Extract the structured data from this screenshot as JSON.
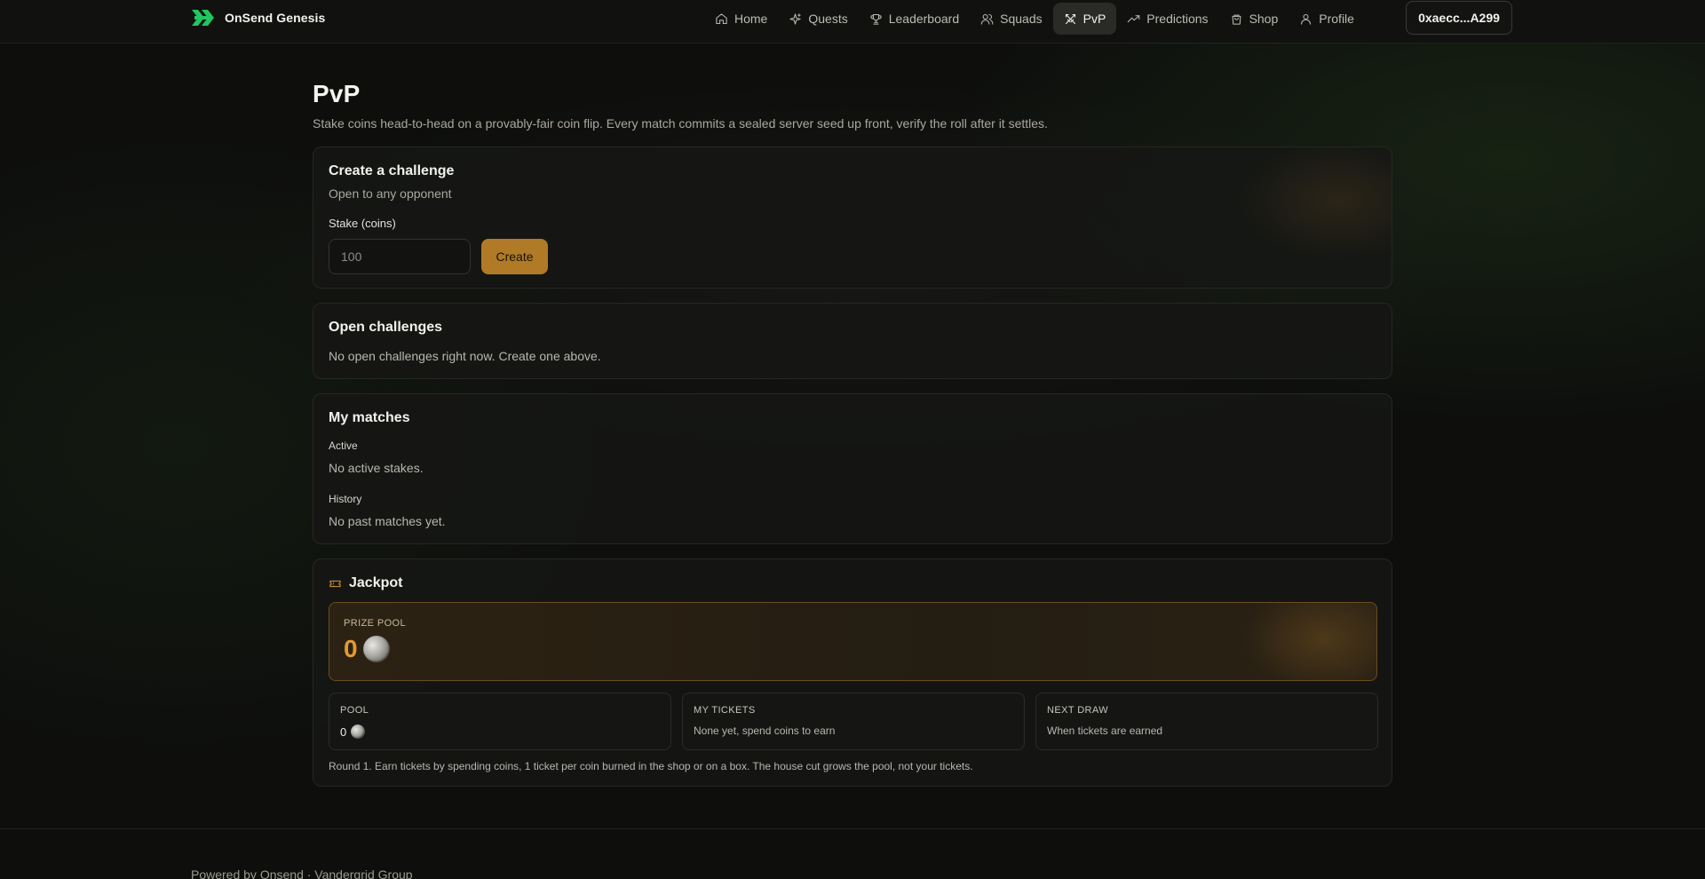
{
  "brand": {
    "name": "OnSend Genesis",
    "accent": "#22c55e"
  },
  "nav": {
    "items": [
      {
        "label": "Home",
        "icon": "home-icon"
      },
      {
        "label": "Quests",
        "icon": "sparkles-icon"
      },
      {
        "label": "Leaderboard",
        "icon": "trophy-icon"
      },
      {
        "label": "Squads",
        "icon": "users-icon"
      },
      {
        "label": "PvP",
        "icon": "swords-icon",
        "active": true
      },
      {
        "label": "Predictions",
        "icon": "trending-up-icon"
      },
      {
        "label": "Shop",
        "icon": "shopping-bag-icon"
      },
      {
        "label": "Profile",
        "icon": "user-icon"
      }
    ],
    "wallet": "0xaecc...A299"
  },
  "page": {
    "title": "PvP",
    "description": "Stake coins head-to-head on a provably-fair coin flip. Every match commits a sealed server seed up front, verify the roll after it settles."
  },
  "create_challenge": {
    "title": "Create a challenge",
    "subtitle": "Open to any opponent",
    "stake_label": "Stake (coins)",
    "stake_placeholder": "100",
    "button": "Create",
    "button_color": "#b07a26"
  },
  "open_challenges": {
    "title": "Open challenges",
    "empty": "No open challenges right now. Create one above."
  },
  "my_matches": {
    "title": "My matches",
    "active_label": "Active",
    "active_empty": "No active stakes.",
    "history_label": "History",
    "history_empty": "No past matches yet."
  },
  "jackpot": {
    "title": "Jackpot",
    "icon": "ticket-icon",
    "prize_pool_label": "PRIZE POOL",
    "prize_pool_value": "0",
    "prize_color": "#e29a31",
    "stats": [
      {
        "label": "POOL",
        "value": "0"
      },
      {
        "label": "MY TICKETS",
        "value": "None yet, spend coins to earn"
      },
      {
        "label": "NEXT DRAW",
        "value": "When tickets are earned"
      }
    ],
    "footnote": "Round 1. Earn tickets by spending coins, 1 ticket per coin burned in the shop or on a box. The house cut grows the pool, not your tickets."
  },
  "footer": {
    "text": "Powered by Onsend · Vandergrid Group"
  }
}
